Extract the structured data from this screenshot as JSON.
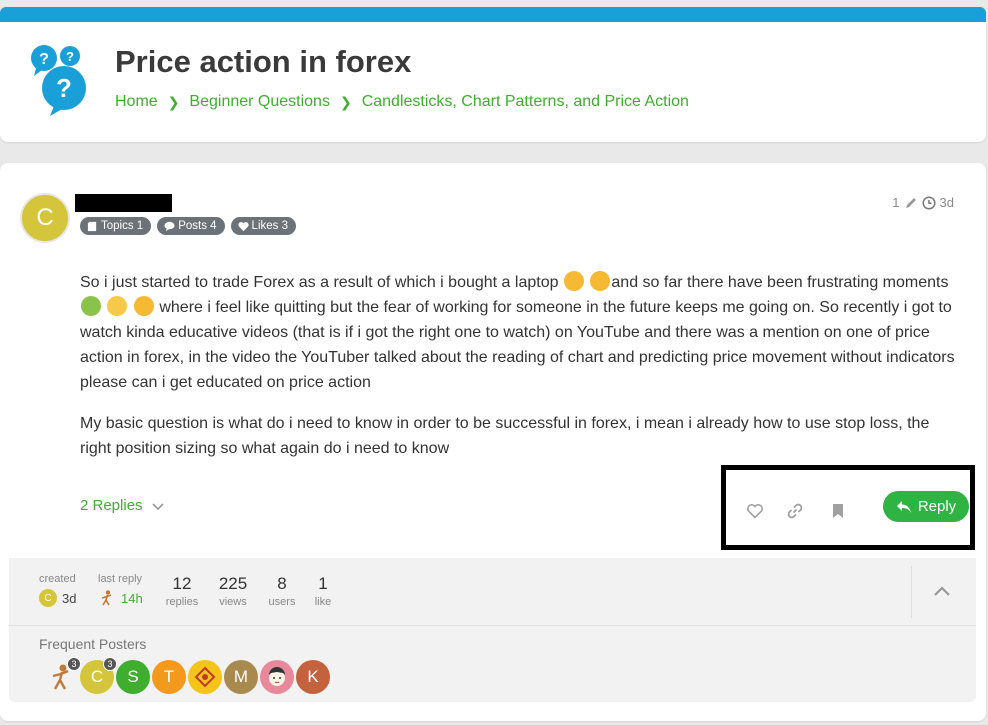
{
  "header": {
    "title": "Price action in forex",
    "breadcrumb": [
      "Home",
      "Beginner Questions",
      "Candlesticks, Chart Patterns, and Price Action"
    ]
  },
  "post": {
    "avatar_letter": "C",
    "badges": {
      "topics": "Topics 1",
      "posts": "Posts 4",
      "likes": "Likes 3"
    },
    "edit_count": "1",
    "age": "3d",
    "paragraph1_parts": [
      "So i just started to trade Forex as a result of which i bought a laptop ",
      "and so far there have been frustrating moments ",
      " where i feel like quitting but the fear of working for someone in the future keeps me going on. So recently i got to watch kinda educative videos (that is if i got the right one to watch) on YouTube and there was a mention on one of price action in forex, in the video the YouTuber talked about the reading of chart and predicting price movement without indicators please can i get educated on price action"
    ],
    "paragraph2": "My basic question is what do i need to know in order to be successful in forex, i mean i already how to use stop loss, the right position sizing so what again do i need to know",
    "replies_toggle": "2 Replies",
    "reply_label": "Reply"
  },
  "summary": {
    "created_label": "created",
    "created_value": "3d",
    "created_avatar": "C",
    "last_reply_label": "last reply",
    "last_reply_value": "14h",
    "stats": [
      {
        "value": "12",
        "label": "replies"
      },
      {
        "value": "225",
        "label": "views"
      },
      {
        "value": "8",
        "label": "users"
      },
      {
        "value": "1",
        "label": "like"
      }
    ],
    "frequent_posters_label": "Frequent Posters",
    "posters": [
      {
        "letter": "",
        "color": "#ffffff",
        "count": "3",
        "kind": "figure"
      },
      {
        "letter": "C",
        "color": "#d5c53b",
        "count": "3",
        "kind": "letter"
      },
      {
        "letter": "S",
        "color": "#3fae2f",
        "count": "",
        "kind": "letter"
      },
      {
        "letter": "T",
        "color": "#f39a1c",
        "count": "",
        "kind": "letter"
      },
      {
        "letter": "",
        "color": "#f5c418",
        "count": "",
        "kind": "pattern"
      },
      {
        "letter": "M",
        "color": "#a98a4e",
        "count": "",
        "kind": "letter"
      },
      {
        "letter": "",
        "color": "#e8899b",
        "count": "",
        "kind": "cartoon"
      },
      {
        "letter": "K",
        "color": "#c4623d",
        "count": "",
        "kind": "letter"
      }
    ]
  },
  "colors": {
    "accent": "#1aa0d8",
    "link": "#3fae2f",
    "reply_button": "#2fb343"
  }
}
